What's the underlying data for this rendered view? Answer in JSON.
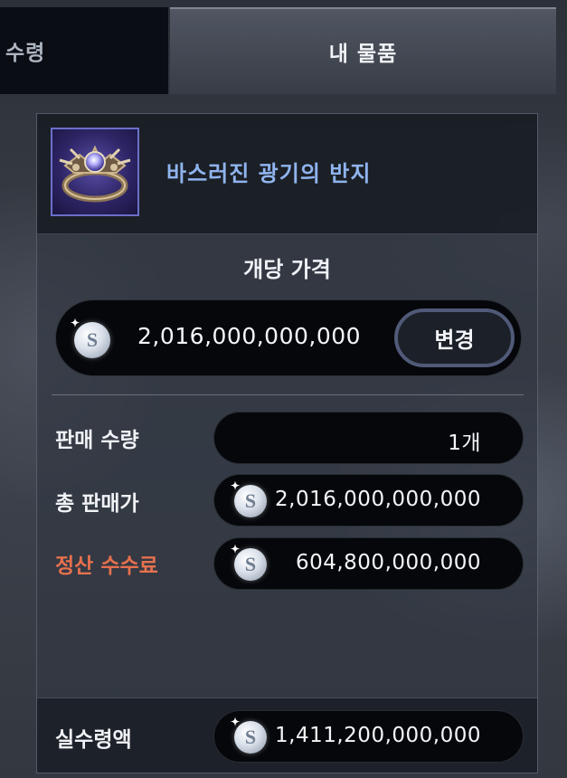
{
  "tabs": {
    "receive": "수령",
    "my_items": "내 물품"
  },
  "item": {
    "name": "바스러진 광기의 반지",
    "icon": "ring-icon"
  },
  "unit_price": {
    "label": "개당 가격",
    "value": "2,016,000,000,000",
    "currency_icon": "silver-coin-icon",
    "change_button": "변경"
  },
  "sale": {
    "quantity_label": "판매 수량",
    "quantity_value": "1개",
    "total_label": "총 판매가",
    "total_value": "2,016,000,000,000",
    "fee_label": "정산 수수료",
    "fee_value": "604,800,000,000",
    "net_label": "실수령액",
    "net_value": "1,411,200,000,000"
  },
  "coin_glyph": "S",
  "colors": {
    "item_name": "#8fb4ee",
    "fee_label": "#e6704e",
    "button_border": "#505a78"
  }
}
